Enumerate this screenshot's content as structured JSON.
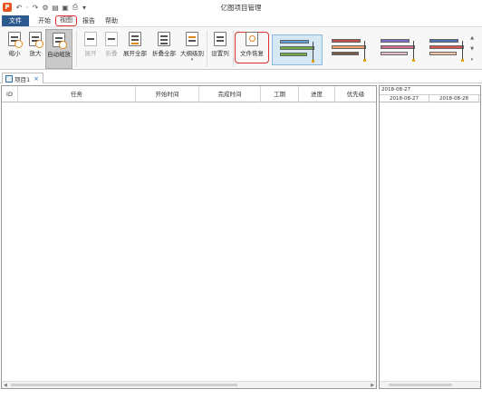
{
  "app": {
    "title": "亿图项目管理",
    "logo": "P"
  },
  "quick_access": [
    "undo-icon",
    "redo-icon",
    "settings-icon",
    "save-icon",
    "print-icon",
    "dropdown-icon"
  ],
  "menu": {
    "file": "文件",
    "items": [
      "开始",
      "视图",
      "报告",
      "帮助"
    ],
    "active_index": 1
  },
  "ribbon": {
    "buttons": [
      {
        "label": "缩小",
        "icon": "zoom-out-icon",
        "state": "normal"
      },
      {
        "label": "放大",
        "icon": "zoom-in-icon",
        "state": "normal"
      },
      {
        "label": "自动缩放",
        "icon": "auto-zoom-icon",
        "state": "selected"
      },
      {
        "label": "展开",
        "icon": "expand-icon",
        "state": "disabled"
      },
      {
        "label": "折叠",
        "icon": "collapse-icon",
        "state": "disabled"
      },
      {
        "label": "展开全部",
        "icon": "expand-all-icon",
        "state": "normal"
      },
      {
        "label": "折叠全部",
        "icon": "collapse-all-icon",
        "state": "normal"
      },
      {
        "label": "大纲级别",
        "icon": "outline-level-icon",
        "state": "normal"
      },
      {
        "label": "设置列",
        "icon": "set-columns-icon",
        "state": "normal"
      },
      {
        "label": "文件恢复",
        "icon": "file-restore-icon",
        "state": "normal"
      }
    ],
    "gantt_styles": [
      "style-1",
      "style-2",
      "style-3",
      "style-4"
    ],
    "selected_style": 0
  },
  "doc_tab": {
    "label": "项目1"
  },
  "table": {
    "columns": [
      "ID",
      "任务",
      "开始时间",
      "完成时间",
      "工期",
      "进度",
      "优先级"
    ]
  },
  "gantt": {
    "month": "2018-08-27",
    "days": [
      "2018-08-27",
      "2018-08-28"
    ]
  },
  "colors": {
    "file_tab": "#2d5a8e",
    "highlight": "#e03030",
    "accent_orange": "#e08a1e"
  }
}
